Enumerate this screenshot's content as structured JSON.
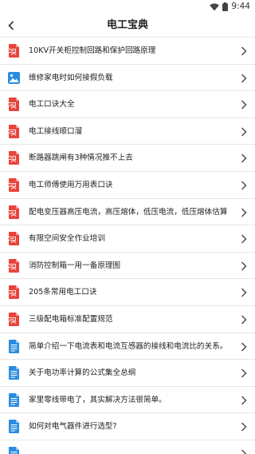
{
  "status_bar": {
    "time": "9:44",
    "wifi_icon": "wifi-icon",
    "battery_icon": "battery-icon"
  },
  "app_bar": {
    "title": "电工宝典",
    "back_icon": "back-arrow-icon"
  },
  "list": {
    "items": [
      {
        "label": "10KV开关柜控制回路和保护回路原理",
        "icon": "pdf"
      },
      {
        "label": "维修家电时如何接假负载",
        "icon": "image"
      },
      {
        "label": "电工口诀大全",
        "icon": "pdf"
      },
      {
        "label": "电工接线顺口溜",
        "icon": "pdf"
      },
      {
        "label": "断路器跳闸有3种情况推不上去",
        "icon": "pdf"
      },
      {
        "label": "电工师傅使用万用表口诀",
        "icon": "pdf"
      },
      {
        "label": "配电变压器高压电流，高压熔体，低压电流，低压熔体估算",
        "icon": "pdf"
      },
      {
        "label": "有限空间安全作业培训",
        "icon": "pdf"
      },
      {
        "label": "消防控制箱一用一备原理图",
        "icon": "pdf"
      },
      {
        "label": "205条常用电工口诀",
        "icon": "pdf"
      },
      {
        "label": "三级配电箱标准配置规范",
        "icon": "pdf"
      },
      {
        "label": "简单介绍一下电流表和电流互感器的接线和电流比的关系。",
        "icon": "doc"
      },
      {
        "label": "关于电功率计算的公式集全总纲",
        "icon": "doc"
      },
      {
        "label": "家里零线带电了，其实解决方法很简单。",
        "icon": "doc"
      },
      {
        "label": "如何对电气器件进行选型?",
        "icon": "doc"
      },
      {
        "label": "",
        "icon": "doc"
      }
    ]
  },
  "colors": {
    "pdf_red": "#e8443a",
    "doc_blue": "#2a8ce0",
    "image_blue": "#2a8ce0",
    "divider": "#e6e6e6"
  }
}
